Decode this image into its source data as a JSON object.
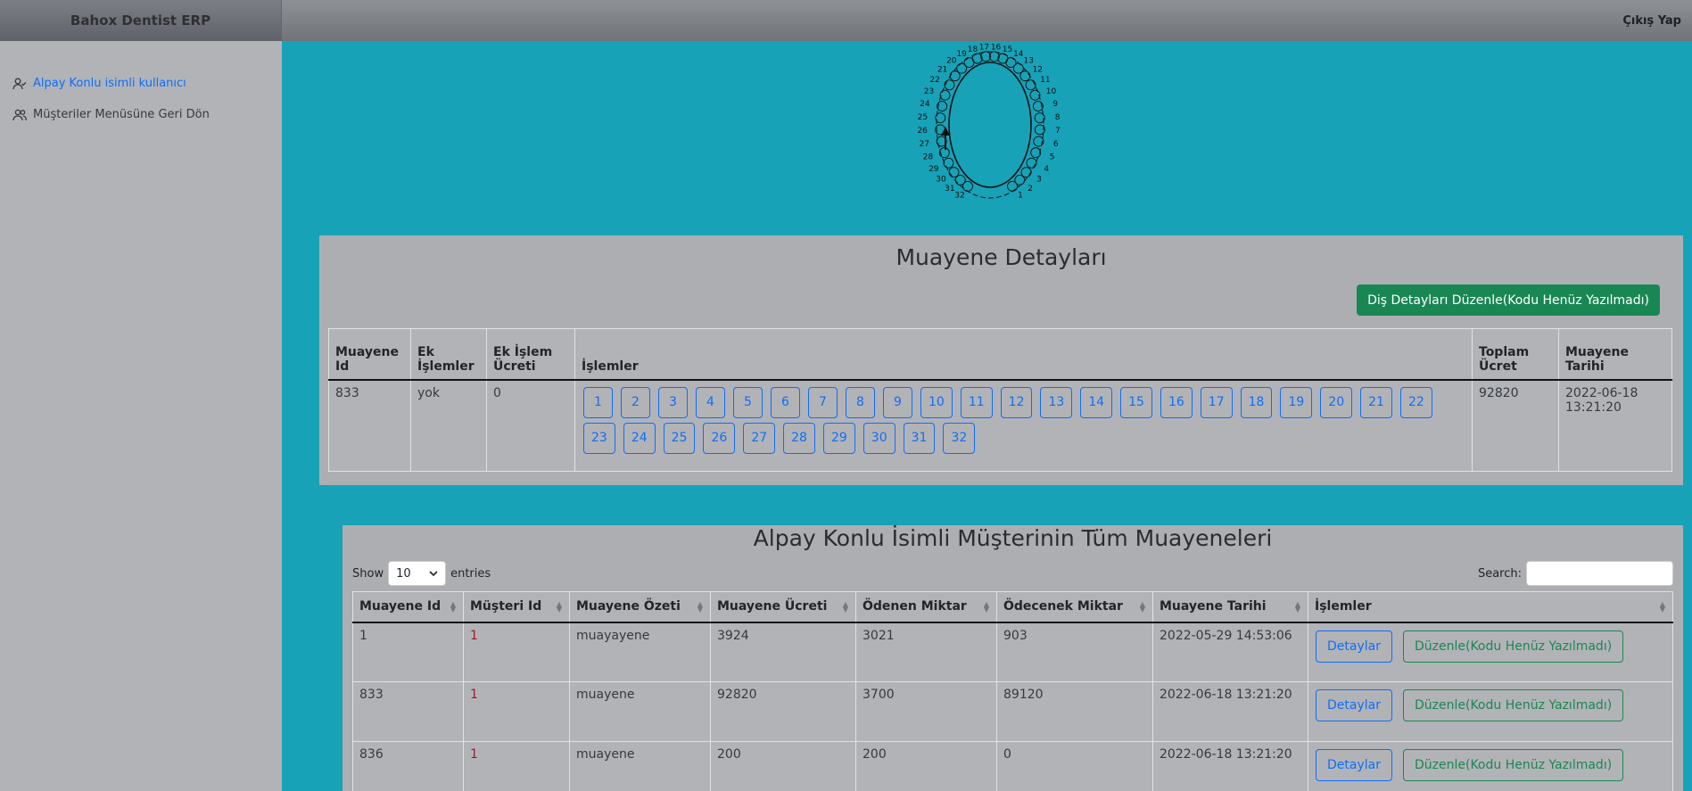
{
  "sidebar": {
    "brand": "Bahox Dentist ERP",
    "items": [
      {
        "label": "Alpay Konlu isimli kullanıcı",
        "icon": "user-check-icon",
        "active": true
      },
      {
        "label": "Müşteriler Menüsüne Geri Dön",
        "icon": "users-icon",
        "active": false
      }
    ]
  },
  "topbar": {
    "logout_label": "Çıkış Yap"
  },
  "tooth_chart": {
    "numbers": [
      "1",
      "2",
      "3",
      "4",
      "5",
      "6",
      "7",
      "8",
      "9",
      "10",
      "11",
      "12",
      "13",
      "14",
      "15",
      "16",
      "17",
      "18",
      "19",
      "20",
      "21",
      "22",
      "23",
      "24",
      "25",
      "26",
      "27",
      "28",
      "29",
      "30",
      "31",
      "32"
    ]
  },
  "details": {
    "title": "Muayene Detayları",
    "edit_button": "Diş Detayları Düzenle(Kodu Henüz Yazılmadı)",
    "headers": {
      "id": "Muayene Id",
      "extra": "Ek İşlemler",
      "extra_fee": "Ek İşlem Ücreti",
      "ops": "İşlemler",
      "total": "Toplam Ücret",
      "date": "Muayene Tarihi"
    },
    "row": {
      "id": "833",
      "extra": "yok",
      "extra_fee": "0",
      "total": "92820",
      "date": "2022-06-18 13:21:20"
    },
    "teeth_buttons": [
      "1",
      "2",
      "3",
      "4",
      "5",
      "6",
      "7",
      "8",
      "9",
      "10",
      "11",
      "12",
      "13",
      "14",
      "15",
      "16",
      "17",
      "18",
      "19",
      "20",
      "21",
      "22",
      "23",
      "24",
      "25",
      "26",
      "27",
      "28",
      "29",
      "30",
      "31",
      "32"
    ]
  },
  "list": {
    "title": "Alpay Konlu İsimli Müşterinin Tüm Muayeneleri",
    "show_label": "Show",
    "entries_value": "10",
    "entries_label": "entries",
    "search_label": "Search:",
    "headers": [
      "Muayene Id",
      "Müşteri Id",
      "Muayene Özeti",
      "Muayene Ücreti",
      "Ödenen Miktar",
      "Ödecenek Miktar",
      "Muayene Tarihi",
      "İşlemler"
    ],
    "detail_button": "Detaylar",
    "edit_button": "Düzenle(Kodu Henüz Yazılmadı)",
    "rows": [
      [
        "1",
        "1",
        "muayayene",
        "3924",
        "3021",
        "903",
        "2022-05-29 14:53:06"
      ],
      [
        "833",
        "1",
        "muayene",
        "92820",
        "3700",
        "89120",
        "2022-06-18 13:21:20"
      ],
      [
        "836",
        "1",
        "muayene",
        "200",
        "200",
        "0",
        "2022-06-18 13:21:20"
      ]
    ]
  },
  "colors": {
    "accent": "#17a2b8",
    "primary": "#0d6efd",
    "success": "#198754",
    "panel": "#adaeb2"
  }
}
